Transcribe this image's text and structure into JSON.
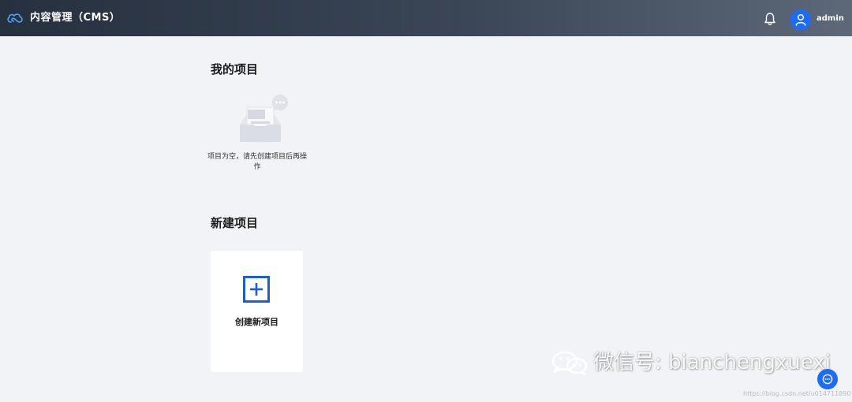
{
  "header": {
    "app_title": "内容管理（CMS）",
    "username": "admin",
    "icons": {
      "logo": "cloud-logo-icon",
      "notifications": "bell-icon",
      "avatar": "user-icon"
    }
  },
  "my_projects": {
    "title": "我的项目",
    "empty_text": "项目为空，请先创建项目后再操作",
    "empty_icon": "empty-inbox-icon"
  },
  "new_project": {
    "title": "新建项目",
    "card_label": "创建新项目",
    "icon": "plus-square-icon"
  },
  "watermark": {
    "text": "微信号: bianchengxuexi",
    "icon": "wechat-icon"
  },
  "chat_button": {
    "icon": "chat-bubble-icon"
  },
  "footer_url": "https://blog.csdn.net/u014711890",
  "colors": {
    "header_start": "#26303f",
    "header_end": "#5d6978",
    "accent": "#1c6bff",
    "background": "#f2f3f6",
    "plus_icon": "#1a5fd6"
  }
}
